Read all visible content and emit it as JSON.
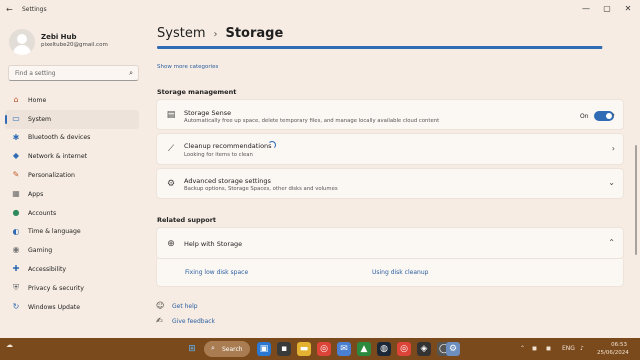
{
  "window": {
    "title": "Settings",
    "back_glyph": "←",
    "controls": [
      "—",
      "▢",
      "✕"
    ]
  },
  "profile": {
    "name": "Zebi Hub",
    "email": "pixeltube20@gmail.com"
  },
  "search": {
    "placeholder": "Find a setting",
    "icon": "search-icon"
  },
  "sidebar": {
    "items": [
      {
        "label": "Home",
        "icon": "home-icon",
        "glyph": "⌂",
        "color": "#c0562b"
      },
      {
        "label": "System",
        "icon": "monitor-icon",
        "glyph": "▭",
        "color": "#2f6cb5",
        "active": true
      },
      {
        "label": "Bluetooth & devices",
        "icon": "bluetooth-icon",
        "glyph": "✱",
        "color": "#2f6cb5"
      },
      {
        "label": "Network & internet",
        "icon": "wifi-icon",
        "glyph": "◆",
        "color": "#2f6cb5"
      },
      {
        "label": "Personalization",
        "icon": "brush-icon",
        "glyph": "✎",
        "color": "#c05a2b"
      },
      {
        "label": "Apps",
        "icon": "apps-icon",
        "glyph": "▦",
        "color": "#6b6b6b"
      },
      {
        "label": "Accounts",
        "icon": "person-icon",
        "glyph": "●",
        "color": "#2f8a5b"
      },
      {
        "label": "Time & language",
        "icon": "globe-clock-icon",
        "glyph": "◐",
        "color": "#2f6cb5"
      },
      {
        "label": "Gaming",
        "icon": "gamepad-icon",
        "glyph": "◉",
        "color": "#777777"
      },
      {
        "label": "Accessibility",
        "icon": "accessibility-icon",
        "glyph": "✚",
        "color": "#2f6cb5"
      },
      {
        "label": "Privacy & security",
        "icon": "shield-icon",
        "glyph": "⛨",
        "color": "#666666"
      },
      {
        "label": "Windows Update",
        "icon": "update-icon",
        "glyph": "↻",
        "color": "#2f6cb5"
      }
    ]
  },
  "main": {
    "breadcrumb": {
      "parent": "System",
      "separator": "›",
      "current": "Storage"
    },
    "storage_bar": {
      "used_fraction": 0.998
    },
    "show_more": "Show more categories",
    "storage_management": {
      "title": "Storage management",
      "storage_sense": {
        "title": "Storage Sense",
        "subtitle": "Automatically free up space, delete temporary files, and manage locally available cloud content",
        "toggle_label": "On",
        "toggle_on": true,
        "icon": "storage-drive-icon"
      },
      "cleanup": {
        "title": "Cleanup recommendations",
        "subtitle": "Looking for items to clean",
        "icon": "broom-icon"
      },
      "advanced": {
        "title": "Advanced storage settings",
        "subtitle": "Backup options, Storage Spaces, other disks and volumes",
        "icon": "gear-icon"
      }
    },
    "related_support": {
      "title": "Related support",
      "help": {
        "title": "Help with Storage",
        "icon": "globe-icon",
        "links": [
          "Fixing low disk space",
          "Using disk cleanup"
        ]
      }
    },
    "footer": {
      "get_help": "Get help",
      "give_feedback": "Give feedback"
    }
  },
  "taskbar": {
    "search_label": "Search",
    "tray_lang": "ENG",
    "time": "06:53",
    "date": "25/06/2024"
  },
  "colors": {
    "accent": "#2f6cb5",
    "background": "#f6ece3",
    "taskbar": "#7a4a1c"
  }
}
